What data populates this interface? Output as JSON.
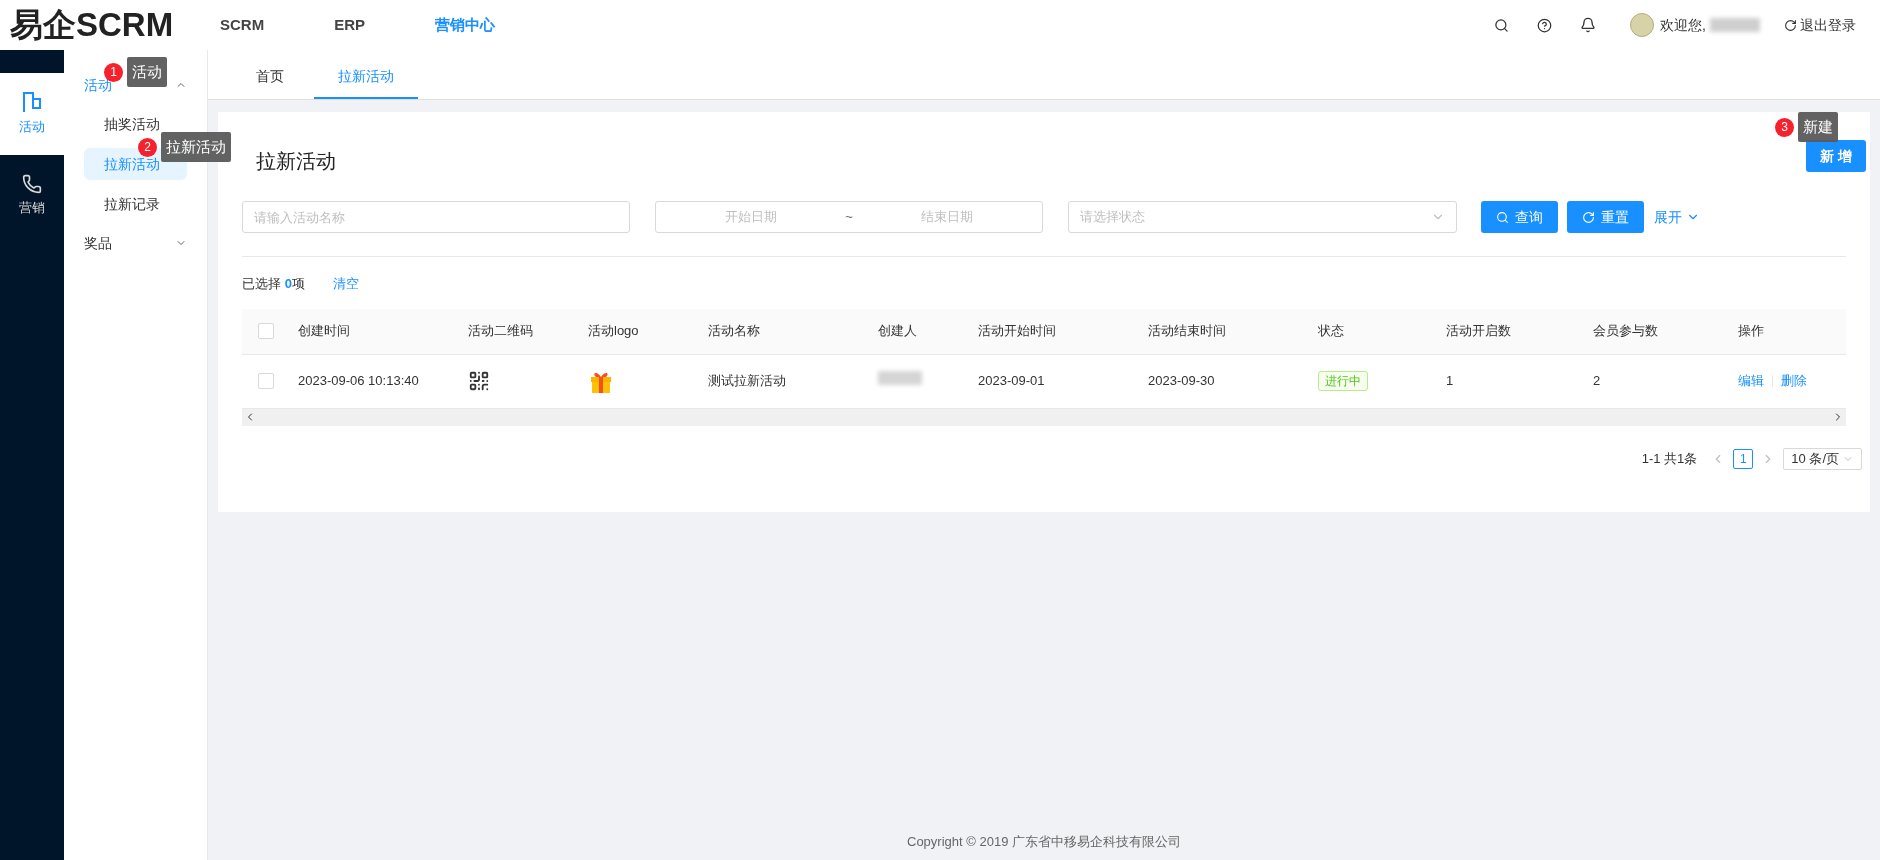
{
  "brand": {
    "logo": "易企SCRM"
  },
  "top_nav": [
    {
      "label": "SCRM",
      "selected": false
    },
    {
      "label": "ERP",
      "selected": false
    },
    {
      "label": "营销中心",
      "selected": true
    }
  ],
  "user": {
    "greeting": "欢迎您,",
    "logout": "退出登录"
  },
  "rail": [
    {
      "label": "活动",
      "selected": true
    },
    {
      "label": "营销",
      "selected": false
    }
  ],
  "menu": [
    {
      "label": "活动",
      "expanded": true,
      "children": [
        {
          "label": "抽奖活动",
          "selected": false
        },
        {
          "label": "拉新活动",
          "selected": true
        },
        {
          "label": "拉新记录",
          "selected": false
        }
      ]
    },
    {
      "label": "奖品",
      "expanded": false
    }
  ],
  "tabs": [
    {
      "label": "首页",
      "selected": false
    },
    {
      "label": "拉新活动",
      "selected": true
    }
  ],
  "page": {
    "title": "拉新活动",
    "add_button": "新 增"
  },
  "filters": {
    "name": {
      "placeholder": "请输入活动名称"
    },
    "start": {
      "placeholder": "开始日期"
    },
    "separator": "~",
    "end": {
      "placeholder": "结束日期"
    },
    "status": {
      "placeholder": "请选择状态"
    },
    "query": "查询",
    "reset": "重置",
    "expand": "展开"
  },
  "selection": {
    "prefix": "已选择 ",
    "count": "0",
    "suffix": "项",
    "clear": "清空"
  },
  "table": {
    "header_checked": false,
    "columns": [
      "创建时间",
      "活动二维码",
      "活动logo",
      "活动名称",
      "创建人",
      "活动开始时间",
      "活动结束时间",
      "状态",
      "活动开启数",
      "会员参与数",
      "操作"
    ],
    "rows": [
      {
        "checked": false,
        "created": "2023-09-06 10:13:40",
        "name": "测试拉新活动",
        "start": "2023-09-01",
        "end": "2023-09-30",
        "status": "进行中",
        "opens": "1",
        "members": "2",
        "actions": [
          "编辑",
          "删除"
        ]
      }
    ]
  },
  "pagination": {
    "summary": "1-1 共1条",
    "pages": [
      {
        "label": "1",
        "selected": true
      }
    ],
    "page_size": "10 条/页"
  },
  "annotations": [
    {
      "number": "1",
      "label": "活动"
    },
    {
      "number": "2",
      "label": "拉新活动"
    },
    {
      "number": "3",
      "label": "新建"
    }
  ],
  "footer": {
    "copyright": "Copyright © 2019 广东省中移易企科技有限公司"
  }
}
